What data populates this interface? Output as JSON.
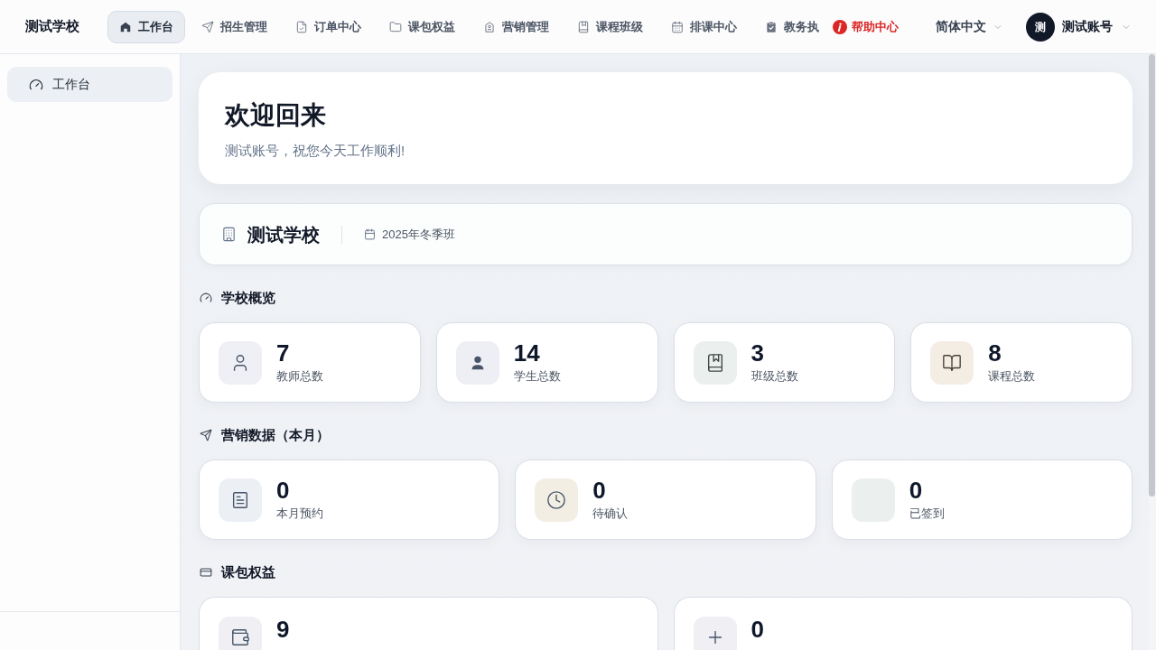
{
  "header": {
    "brand": "测试学校",
    "nav": [
      {
        "label": "工作台",
        "selected": true
      },
      {
        "label": "招生管理",
        "selected": false
      },
      {
        "label": "订单中心",
        "selected": false
      },
      {
        "label": "课包权益",
        "selected": false
      },
      {
        "label": "营销管理",
        "selected": false
      },
      {
        "label": "课程班级",
        "selected": false
      },
      {
        "label": "排课中心",
        "selected": false
      },
      {
        "label": "教务执",
        "selected": false
      }
    ],
    "help": {
      "label": "帮助中心"
    },
    "language": "简体中文",
    "user": {
      "avatar_text": "测",
      "name": "测试账号"
    }
  },
  "sidebar": {
    "items": [
      {
        "label": "工作台",
        "selected": true
      }
    ]
  },
  "welcome": {
    "title": "欢迎回来",
    "subtitle": "测试账号，祝您今天工作顺利!"
  },
  "school": {
    "name": "测试学校",
    "term": "2025年冬季班"
  },
  "sections": [
    {
      "title": "学校概览",
      "items": [
        {
          "value": "7",
          "label": "教师总数",
          "color": "#eef0f5"
        },
        {
          "value": "14",
          "label": "学生总数",
          "color": "#eeeff5"
        },
        {
          "value": "3",
          "label": "班级总数",
          "color": "#ebefed"
        },
        {
          "value": "8",
          "label": "课程总数",
          "color": "#f4ede4"
        }
      ]
    },
    {
      "title": "营销数据（本月）",
      "items": [
        {
          "value": "0",
          "label": "本月预约",
          "color": "#eceff4"
        },
        {
          "value": "0",
          "label": "待确认",
          "color": "#f3eee4"
        },
        {
          "value": "0",
          "label": "已签到",
          "color": "#ebefed"
        }
      ]
    },
    {
      "title": "课包权益",
      "items": [
        {
          "value": "9",
          "color": "#efeff4"
        },
        {
          "value": "0",
          "color": "#efeff4"
        }
      ]
    }
  ]
}
